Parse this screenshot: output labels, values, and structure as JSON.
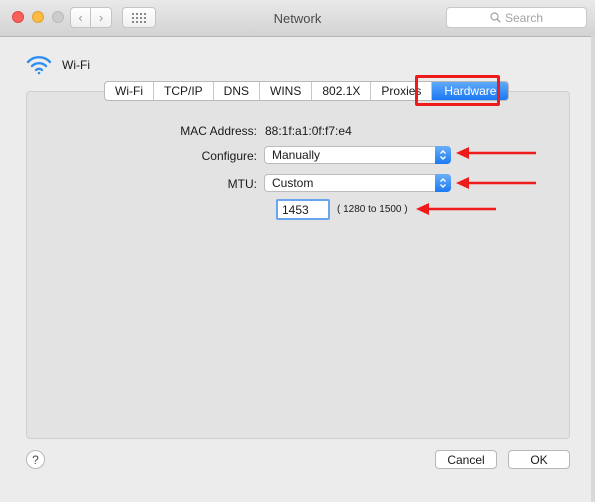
{
  "window": {
    "title": "Network"
  },
  "search": {
    "placeholder": "Search"
  },
  "interface": {
    "name": "Wi-Fi"
  },
  "tabs": [
    {
      "label": "Wi-Fi"
    },
    {
      "label": "TCP/IP"
    },
    {
      "label": "DNS"
    },
    {
      "label": "WINS"
    },
    {
      "label": "802.1X"
    },
    {
      "label": "Proxies"
    },
    {
      "label": "Hardware",
      "selected": true
    }
  ],
  "hardware": {
    "mac_label": "MAC Address:",
    "mac_value": "88:1f:a1:0f:f7:e4",
    "configure_label": "Configure:",
    "configure_value": "Manually",
    "mtu_label": "MTU:",
    "mtu_value": "Custom",
    "mtu_custom": "1453",
    "mtu_range": "( 1280 to 1500 )"
  },
  "buttons": {
    "help": "?",
    "cancel": "Cancel",
    "ok": "OK"
  },
  "colors": {
    "accent": "#1b78f2",
    "annotation": "#ef1b1b"
  },
  "icons": {
    "nav_back": "‹",
    "nav_forward": "›"
  }
}
